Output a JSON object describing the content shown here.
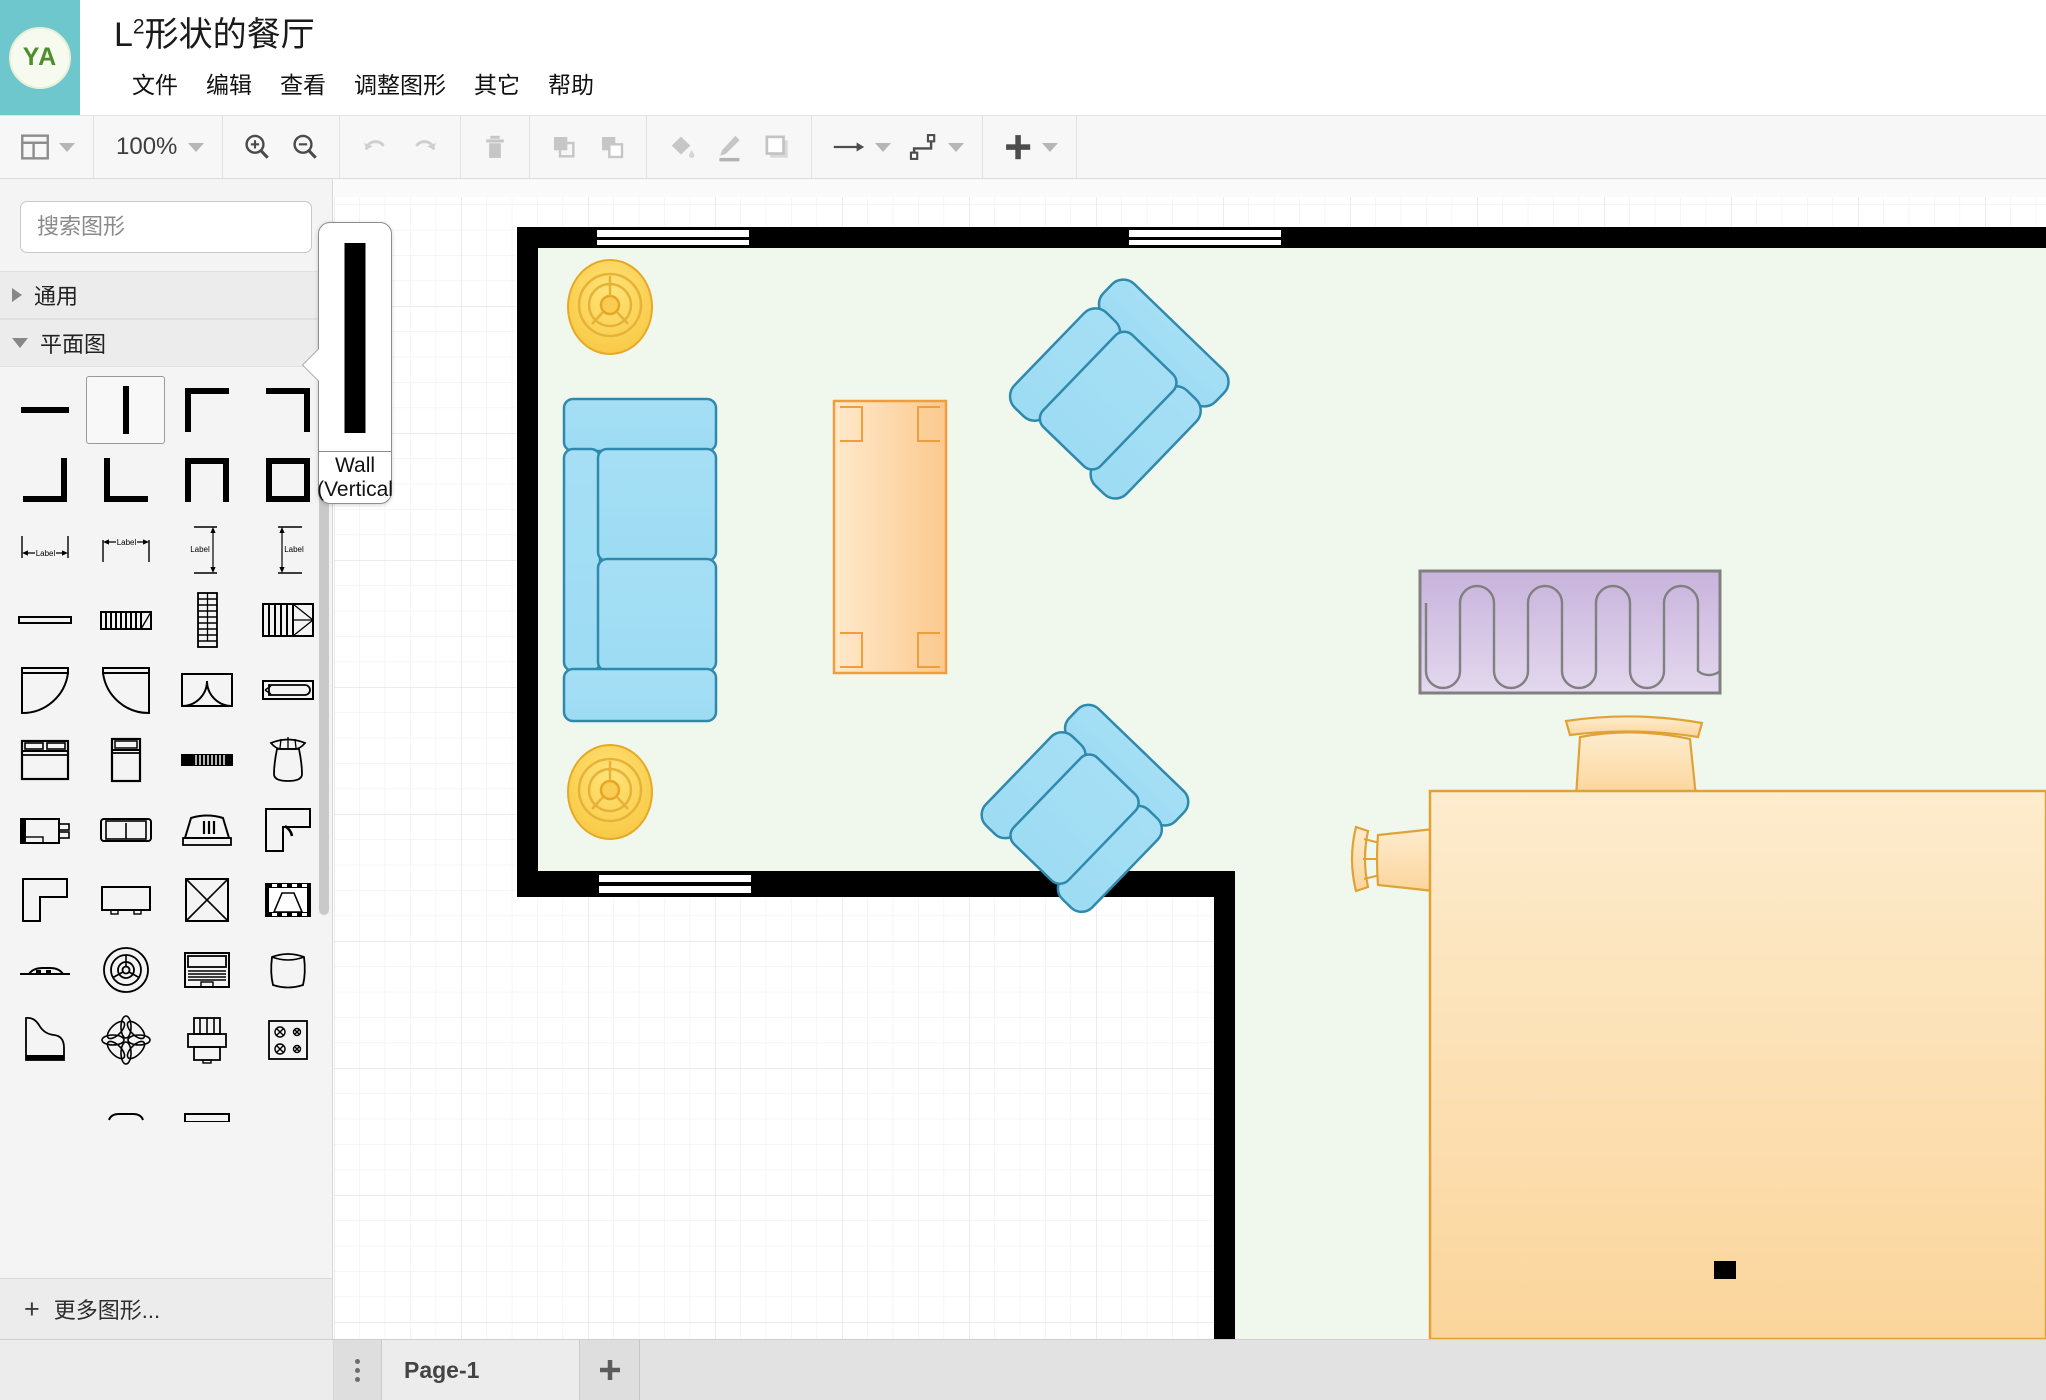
{
  "header": {
    "logo_text": "YA",
    "title_main": "L",
    "title_sup": "2",
    "title_rest": "形状的餐厅",
    "menu": [
      {
        "label": "文件",
        "name": "menu-file"
      },
      {
        "label": "编辑",
        "name": "menu-edit"
      },
      {
        "label": "查看",
        "name": "menu-view"
      },
      {
        "label": "调整图形",
        "name": "menu-arrange"
      },
      {
        "label": "其它",
        "name": "menu-extras"
      },
      {
        "label": "帮助",
        "name": "menu-help"
      }
    ]
  },
  "toolbar": {
    "view_layout_icon": "panel-layout-icon",
    "zoom_level": "100%",
    "zoom_in_icon": "zoom-in-icon",
    "zoom_out_icon": "zoom-out-icon",
    "undo_icon": "undo-icon",
    "redo_icon": "redo-icon",
    "delete_icon": "trash-icon",
    "to_front_icon": "bring-to-front-icon",
    "to_back_icon": "send-to-back-icon",
    "fill_icon": "fill-color-icon",
    "line_icon": "line-color-icon",
    "shadow_icon": "shadow-icon",
    "connection_icon": "connection-arrow-icon",
    "waypoint_icon": "waypoints-icon",
    "insert_icon": "insert-plus-icon"
  },
  "sidebar": {
    "search_placeholder": "搜索图形",
    "search_value": "",
    "search_icon": "search-icon",
    "sections": [
      {
        "label": "通用",
        "expanded": false
      },
      {
        "label": "平面图",
        "expanded": true
      }
    ],
    "more_shapes_label": "更多图形...",
    "shapes": [
      {
        "name": "wall-horizontal",
        "selected": false
      },
      {
        "name": "wall-vertical",
        "selected": true
      },
      {
        "name": "wall-corner-top-left",
        "selected": false
      },
      {
        "name": "wall-corner-top-right",
        "selected": false
      },
      {
        "name": "wall-corner-bottom-right",
        "selected": false
      },
      {
        "name": "wall-corner-bottom-left",
        "selected": false
      },
      {
        "name": "wall-u-shape",
        "selected": false
      },
      {
        "name": "wall-square",
        "selected": false
      },
      {
        "name": "dimension-horizontal-inner",
        "selected": false
      },
      {
        "name": "dimension-horizontal-outer",
        "selected": false
      },
      {
        "name": "dimension-vertical-inner",
        "selected": false
      },
      {
        "name": "dimension-vertical-outer",
        "selected": false
      },
      {
        "name": "wall-thin",
        "selected": false
      },
      {
        "name": "stairs-horizontal",
        "selected": false
      },
      {
        "name": "stairs-vertical",
        "selected": false
      },
      {
        "name": "stairs-u-turn",
        "selected": false
      },
      {
        "name": "door-left-swing",
        "selected": false
      },
      {
        "name": "door-right-swing",
        "selected": false
      },
      {
        "name": "door-double-swing",
        "selected": false
      },
      {
        "name": "door-sliding",
        "selected": false
      },
      {
        "name": "bed-double",
        "selected": false
      },
      {
        "name": "bed-single",
        "selected": false
      },
      {
        "name": "sofa-long",
        "selected": false
      },
      {
        "name": "chair-rounded",
        "selected": false
      },
      {
        "name": "tv-set",
        "selected": false
      },
      {
        "name": "sofa-two-seat",
        "selected": false
      },
      {
        "name": "armchair-top",
        "selected": false
      },
      {
        "name": "counter-corner",
        "selected": false
      },
      {
        "name": "counter-l-shape",
        "selected": false
      },
      {
        "name": "desk-rectangular",
        "selected": false
      },
      {
        "name": "square-crossed",
        "selected": false
      },
      {
        "name": "projector-screen",
        "selected": false
      },
      {
        "name": "bench-low",
        "selected": false
      },
      {
        "name": "ceiling-fan",
        "selected": false
      },
      {
        "name": "laptop-open",
        "selected": false
      },
      {
        "name": "pouf-round",
        "selected": false
      },
      {
        "name": "piano-grand",
        "selected": false
      },
      {
        "name": "plant-flower",
        "selected": false
      },
      {
        "name": "armchair-front",
        "selected": false
      },
      {
        "name": "stove-four-burner",
        "selected": false
      }
    ]
  },
  "canvas": {
    "grid_minor_color": "#ececec",
    "grid_major_color": "#d9d9d9",
    "room_fill": "#f0f7ed",
    "wall_color": "#000000",
    "sofa_fill": "#a8e0f5",
    "sofa_stroke": "#2f89ad",
    "table_fill": "#fbd6a6",
    "table_stroke": "#f0a94e",
    "curtain_fill": "#ded0e8",
    "curtain_stroke": "#808080",
    "fan_fill": "#ffd64f",
    "fan_stroke": "#e8a820",
    "dining_fill": "#fce2b4",
    "dining_stroke": "#e0a236"
  },
  "bottom": {
    "page_label": "Page-1",
    "kebab_icon": "page-menu-icon",
    "add_page_icon": "add-page-icon"
  }
}
